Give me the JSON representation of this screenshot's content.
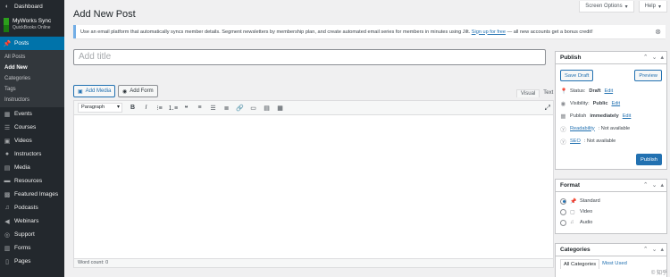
{
  "sidebar": {
    "dashboard": "Dashboard",
    "myworks": {
      "title": "MyWorks Sync",
      "subtitle": "QuickBooks Online"
    },
    "posts": "Posts",
    "posts_sub": [
      "All Posts",
      "Add New",
      "Categories",
      "Tags",
      "Instructors"
    ],
    "items": [
      "Events",
      "Courses",
      "Videos",
      "Instructors",
      "Media",
      "Resources",
      "Featured Images",
      "Podcasts",
      "Webinars",
      "Support",
      "Forms",
      "Pages"
    ]
  },
  "top": {
    "screen_options": "Screen Options",
    "help": "Help"
  },
  "page_title": "Add New Post",
  "notice": {
    "text": "Use an email platform that automatically syncs member details. Segment newsletters by membership plan, and create automated email series for members in minutes using Jilt.",
    "link": "Sign up for free",
    "rest": "— all new accounts get a bonus credit!"
  },
  "post_title_placeholder": "Add title",
  "media": {
    "add_media": "Add Media",
    "add_form": "Add Form"
  },
  "tabs": {
    "visual": "Visual",
    "text": "Text"
  },
  "editor": {
    "format": "Paragraph",
    "word_count": "Word count: 0"
  },
  "publish": {
    "title": "Publish",
    "save_draft": "Save Draft",
    "preview": "Preview",
    "status_label": "Status: ",
    "status_value": "Draft",
    "visibility_label": "Visibility: ",
    "visibility_value": "Public",
    "publish_label": "Publish ",
    "publish_value": "immediately",
    "edit": "Edit",
    "readability_link": "Readability",
    "readability_value": ": Not available",
    "seo_link": "SEO",
    "seo_value": ": Not available",
    "publish_button": "Publish"
  },
  "format_box": {
    "title": "Format",
    "options": [
      "Standard",
      "Video",
      "Audio"
    ],
    "selected": "Standard"
  },
  "categories": {
    "title": "Categories",
    "tabs": [
      "All Categories",
      "Most Used"
    ]
  },
  "watermark": "© 知乎"
}
